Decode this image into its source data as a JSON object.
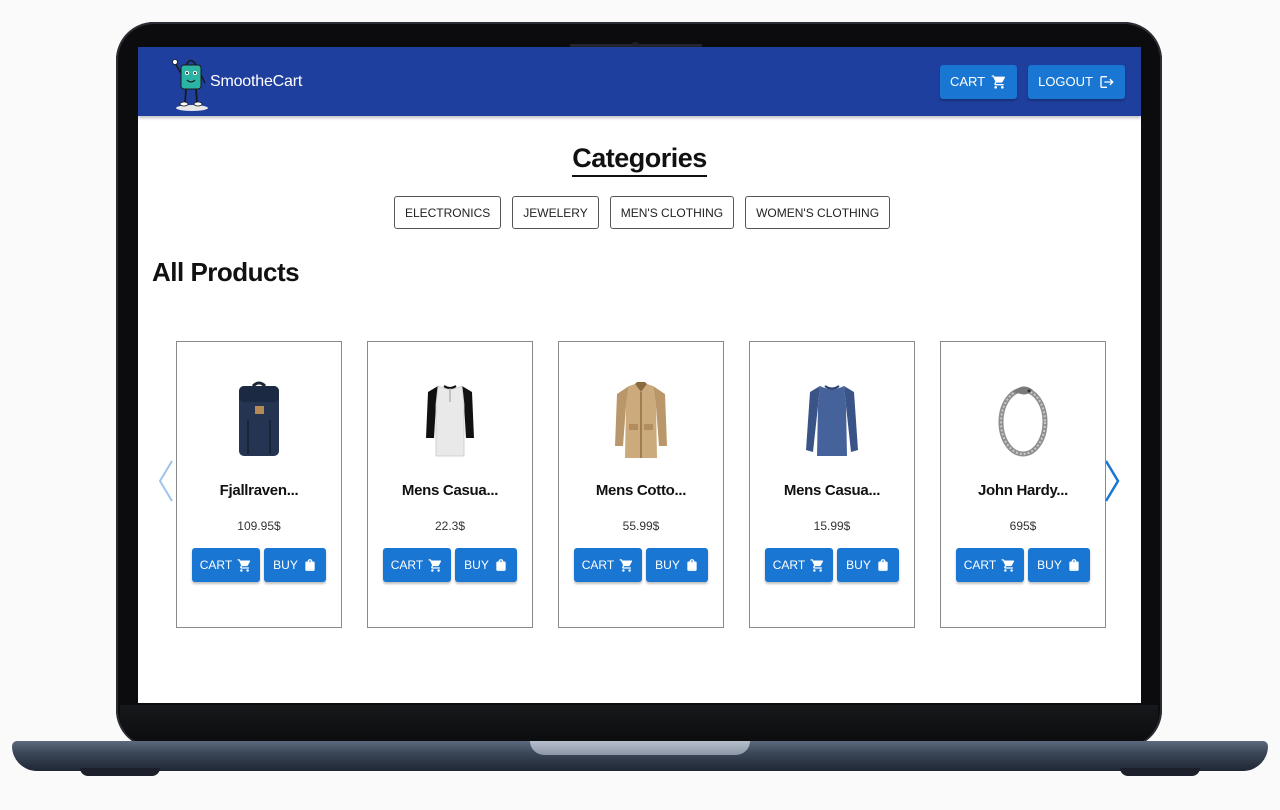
{
  "header": {
    "brand": "SmootheCart",
    "cart_label": "CART",
    "logout_label": "LOGOUT"
  },
  "categories": {
    "title": "Categories",
    "items": [
      "ELECTRONICS",
      "JEWELERY",
      "MEN'S CLOTHING",
      "WOMEN'S CLOTHING"
    ]
  },
  "products": {
    "title": "All Products",
    "cart_label": "CART",
    "buy_label": "BUY",
    "items": [
      {
        "name": "Fjallraven...",
        "price": "109.95$",
        "image": "backpack"
      },
      {
        "name": "Mens Casua...",
        "price": "22.3$",
        "image": "raglan-shirt"
      },
      {
        "name": "Mens Cotto...",
        "price": "55.99$",
        "image": "cotton-jacket"
      },
      {
        "name": "Mens Casua...",
        "price": "15.99$",
        "image": "slim-fit-tee"
      },
      {
        "name": "John Hardy...",
        "price": "695$",
        "image": "dragon-bracelet"
      }
    ]
  },
  "colors": {
    "appbar": "#1f3f9e",
    "button": "#1976d2",
    "arrow": "#1976d2"
  }
}
